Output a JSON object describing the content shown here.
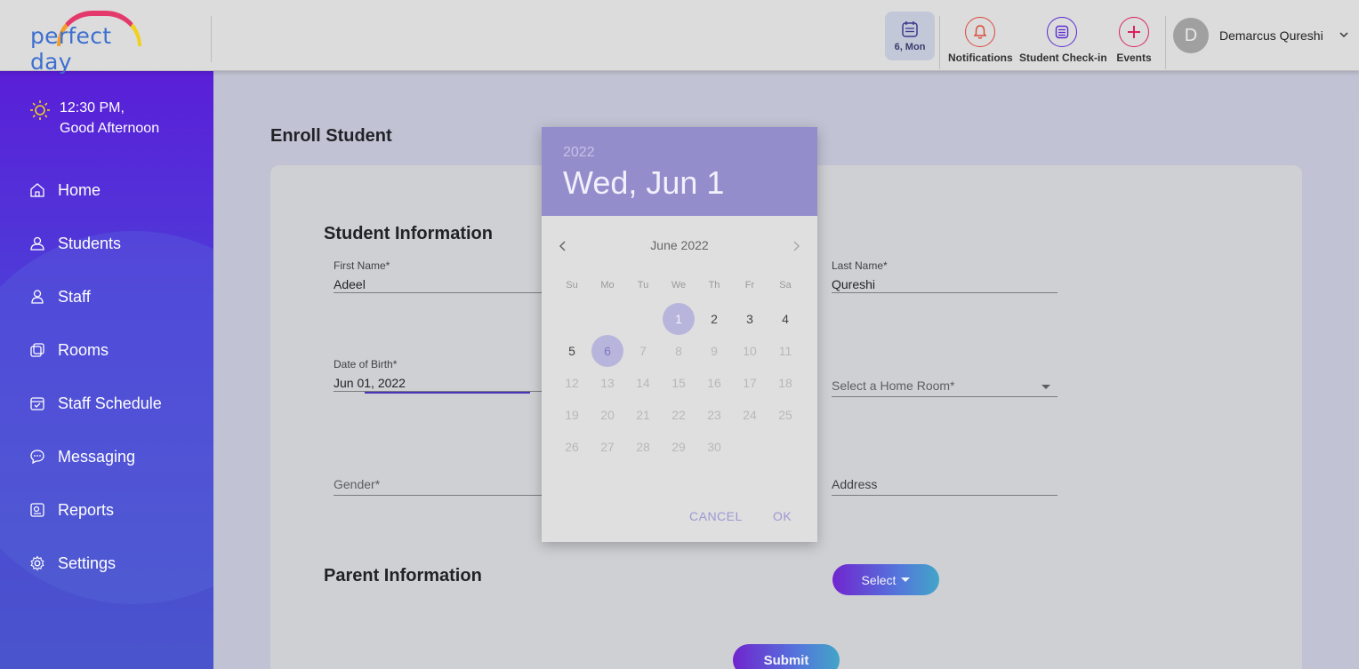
{
  "header": {
    "logo_text": "perfect day",
    "date_chip": "6, Mon",
    "notifications_label": "Notifications",
    "checkin_label": "Student Check-in",
    "events_label": "Events",
    "user_initial": "D",
    "user_name": "Demarcus Qureshi"
  },
  "sidebar": {
    "greeting_time": "12:30 PM,",
    "greeting_text": "Good Afternoon",
    "items": [
      {
        "label": "Home",
        "icon": "home-icon"
      },
      {
        "label": "Students",
        "icon": "students-icon"
      },
      {
        "label": "Staff",
        "icon": "staff-icon"
      },
      {
        "label": "Rooms",
        "icon": "rooms-icon"
      },
      {
        "label": "Staff Schedule",
        "icon": "calendar-check-icon"
      },
      {
        "label": "Messaging",
        "icon": "chat-icon"
      },
      {
        "label": "Reports",
        "icon": "reports-icon"
      },
      {
        "label": "Settings",
        "icon": "gear-icon"
      }
    ]
  },
  "main": {
    "page_title": "Enroll Student",
    "student_section": "Student Information",
    "first_name_label": "First Name*",
    "first_name_value": "Adeel",
    "last_name_label": "Last Name*",
    "last_name_value": "Qureshi",
    "dob_label": "Date of Birth*",
    "dob_value": "Jun 01, 2022",
    "home_room_placeholder": "Select a Home Room*",
    "gender_placeholder": "Gender*",
    "address_placeholder": "Address",
    "parent_section": "Parent Information",
    "select_label": "Select",
    "submit_label": "Submit"
  },
  "datepicker": {
    "year": "2022",
    "selected_date": "Wed, Jun 1",
    "month_label": "June 2022",
    "weekdays": [
      "Su",
      "Mo",
      "Tu",
      "We",
      "Th",
      "Fr",
      "Sa"
    ],
    "cancel_label": "CANCEL",
    "ok_label": "OK",
    "selected_day": 1,
    "today_day": 6,
    "enabled_days": [
      1,
      2,
      3,
      4,
      5,
      6
    ]
  },
  "colors": {
    "sidebar_top": "#5a1fd8",
    "sidebar_bottom": "#4a55cc",
    "picker_header": "#948dcb",
    "accent": "#3d2ab8",
    "events_red": "#d8245f"
  }
}
